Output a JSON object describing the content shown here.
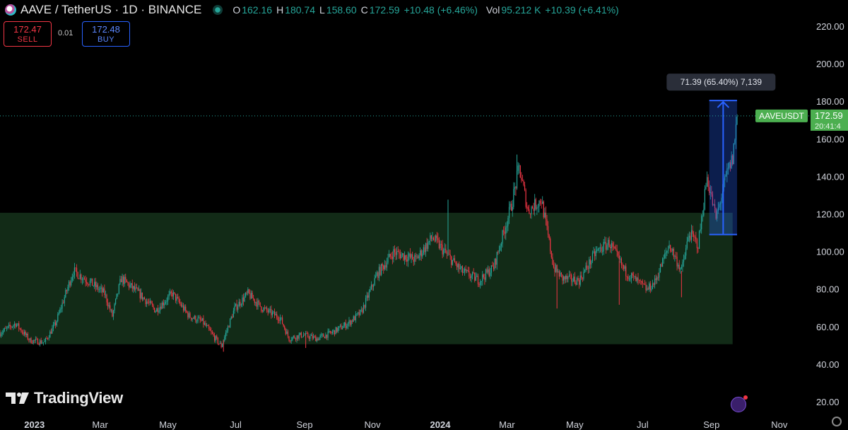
{
  "header": {
    "title": "AAVE / TetherUS · 1D · BINANCE",
    "o_label": "O",
    "o_value": "162.16",
    "h_label": "H",
    "h_value": "180.74",
    "l_label": "L",
    "l_value": "158.60",
    "c_label": "C",
    "c_value": "172.59",
    "change": "+10.48 (+6.46%)",
    "vol_label": "Vol",
    "vol_value": "95.212 K",
    "vol_change": "+10.39 (+6.41%)"
  },
  "trade": {
    "sell_price": "172.47",
    "sell_label": "SELL",
    "spread": "0.01",
    "buy_price": "172.48",
    "buy_label": "BUY"
  },
  "watermark": "TradingView",
  "colors": {
    "up": "#26a69a",
    "down": "#f23645",
    "zone": "#14301a",
    "measure": "#2962ff",
    "price_tag": "#4caf50"
  },
  "chart_data": {
    "type": "candlestick",
    "symbol": "AAVEUSDT",
    "last_price": "172.59",
    "last_time": "20:41:4",
    "ylim": [
      20,
      220
    ],
    "y_ticks": [
      "220.00",
      "200.00",
      "180.00",
      "160.00",
      "140.00",
      "120.00",
      "100.00",
      "80.00",
      "60.00",
      "40.00",
      "20.00"
    ],
    "x_labels": [
      "2023",
      "Mar",
      "May",
      "Jul",
      "Sep",
      "Nov",
      "2024",
      "Mar",
      "May",
      "Jul",
      "Sep",
      "Nov"
    ],
    "x_label_dates": [
      "2023-01-01",
      "2023-03-01",
      "2023-05-01",
      "2023-07-01",
      "2023-09-01",
      "2023-11-01",
      "2024-01-01",
      "2024-03-01",
      "2024-05-01",
      "2024-07-01",
      "2024-09-01",
      "2024-11-01"
    ],
    "x_range": [
      "2022-12-01",
      "2024-12-01"
    ],
    "bold_x_labels": [
      "2023",
      "2024"
    ],
    "range_zone": {
      "from": "2022-12-01",
      "to": "2024-09-20",
      "low": 51,
      "high": 121
    },
    "measure": {
      "from": "2024-08-30",
      "to": "2024-09-24",
      "low": 109.4,
      "high": 180.8,
      "label": "71.39 (65.40%) 7,139"
    },
    "path": [
      [
        "2022-12-01",
        57
      ],
      [
        "2022-12-15",
        62
      ],
      [
        "2022-12-28",
        53
      ],
      [
        "2023-01-10",
        52
      ],
      [
        "2023-01-20",
        62
      ],
      [
        "2023-02-05",
        90
      ],
      [
        "2023-02-20",
        84
      ],
      [
        "2023-03-05",
        78
      ],
      [
        "2023-03-12",
        66
      ],
      [
        "2023-03-20",
        86
      ],
      [
        "2023-04-05",
        78
      ],
      [
        "2023-04-20",
        69
      ],
      [
        "2023-05-05",
        78
      ],
      [
        "2023-05-20",
        66
      ],
      [
        "2023-06-01",
        63
      ],
      [
        "2023-06-10",
        56
      ],
      [
        "2023-06-18",
        50
      ],
      [
        "2023-06-30",
        70
      ],
      [
        "2023-07-12",
        78
      ],
      [
        "2023-07-25",
        70
      ],
      [
        "2023-08-10",
        65
      ],
      [
        "2023-08-18",
        54
      ],
      [
        "2023-08-30",
        56
      ],
      [
        "2023-09-12",
        54
      ],
      [
        "2023-09-25",
        57
      ],
      [
        "2023-10-10",
        62
      ],
      [
        "2023-10-22",
        68
      ],
      [
        "2023-11-05",
        88
      ],
      [
        "2023-11-20",
        100
      ],
      [
        "2023-12-10",
        96
      ],
      [
        "2023-12-25",
        108
      ],
      [
        "2024-01-05",
        100
      ],
      [
        "2024-01-20",
        90
      ],
      [
        "2024-02-05",
        85
      ],
      [
        "2024-02-18",
        92
      ],
      [
        "2024-03-05",
        125
      ],
      [
        "2024-03-12",
        145
      ],
      [
        "2024-03-20",
        122
      ],
      [
        "2024-04-01",
        128
      ],
      [
        "2024-04-12",
        92
      ],
      [
        "2024-04-20",
        86
      ],
      [
        "2024-05-05",
        85
      ],
      [
        "2024-05-20",
        100
      ],
      [
        "2024-06-01",
        105
      ],
      [
        "2024-06-15",
        90
      ],
      [
        "2024-07-05",
        80
      ],
      [
        "2024-07-12",
        84
      ],
      [
        "2024-07-25",
        104
      ],
      [
        "2024-08-05",
        90
      ],
      [
        "2024-08-12",
        110
      ],
      [
        "2024-08-20",
        104
      ],
      [
        "2024-08-28",
        140
      ],
      [
        "2024-09-05",
        118
      ],
      [
        "2024-09-15",
        142
      ],
      [
        "2024-09-20",
        150
      ],
      [
        "2024-09-24",
        172.59
      ]
    ],
    "spikes": [
      [
        "2024-01-08",
        128
      ],
      [
        "2024-03-10",
        152
      ],
      [
        "2024-04-15",
        70
      ],
      [
        "2024-06-10",
        72
      ],
      [
        "2024-08-05",
        76
      ],
      [
        "2023-06-20",
        47
      ],
      [
        "2023-09-02",
        49
      ]
    ]
  }
}
